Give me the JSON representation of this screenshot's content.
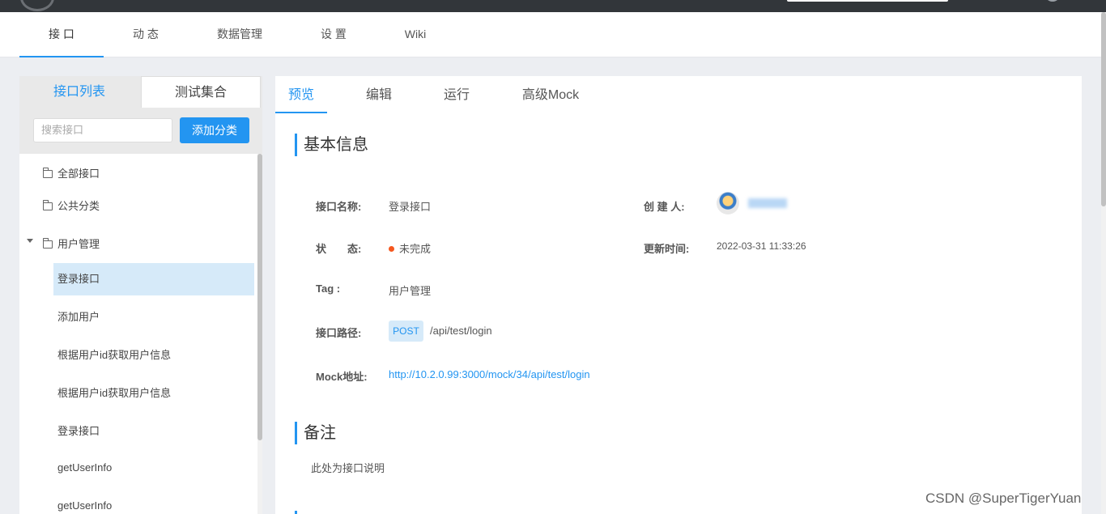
{
  "top_tabs": [
    "接 口",
    "动 态",
    "数据管理",
    "设 置",
    "Wiki"
  ],
  "left": {
    "tabs": [
      "接口列表",
      "测试集合"
    ],
    "search_placeholder": "搜索接口",
    "add_button": "添加分类",
    "items": [
      "全部接口",
      "公共分类",
      "用户管理",
      "登录接口",
      "添加用户",
      "根据用户id获取用户信息",
      "根据用户id获取用户信息",
      "登录接口",
      "getUserInfo",
      "getUserInfo"
    ]
  },
  "right": {
    "tabs": [
      "预览",
      "编辑",
      "运行",
      "高级Mock"
    ],
    "basic_info_title": "基本信息",
    "fields": {
      "name_label": "接口名称:",
      "name_value": "登录接口",
      "creator_label": "创 建 人:",
      "status_label": "状　　态:",
      "status_value": "未完成",
      "updated_label": "更新时间:",
      "updated_value": "2022-03-31 11:33:26",
      "tag_label": "Tag :",
      "tag_value": "用户管理",
      "path_label": "接口路径:",
      "method": "POST",
      "path_value": "/api/test/login",
      "mock_label": "Mock地址:",
      "mock_value": "http://10.2.0.99:3000/mock/34/api/test/login"
    },
    "remark_title": "备注",
    "remark_text": "此处为接口说明"
  },
  "watermark": "CSDN @SuperTigerYuan",
  "colors": {
    "accent": "#2395f1",
    "status_dot": "#f5571e",
    "topbar": "#32363a"
  }
}
